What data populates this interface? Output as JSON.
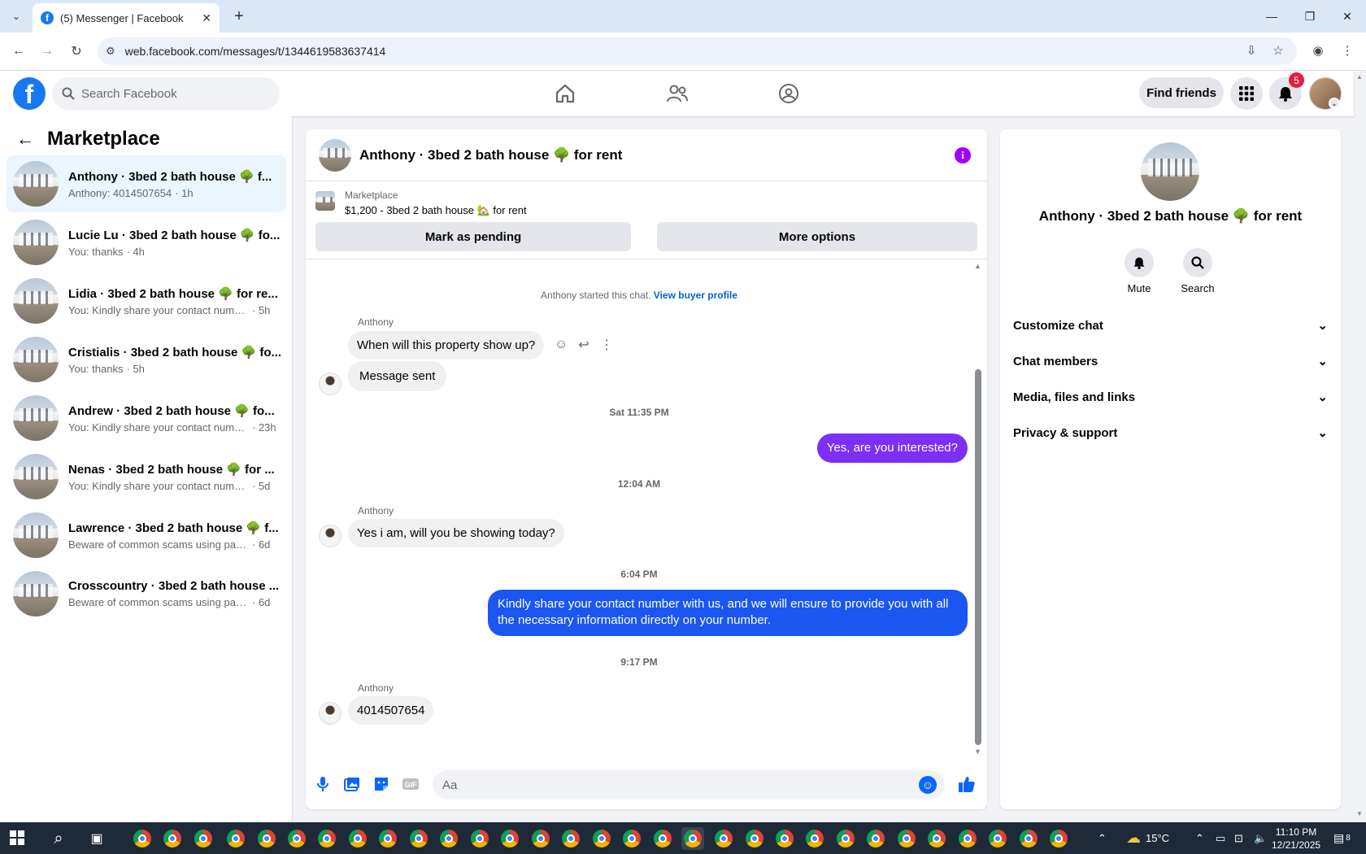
{
  "browser": {
    "tab_title": "(5) Messenger | Facebook",
    "url": "web.facebook.com/messages/t/1344619583637414"
  },
  "header": {
    "search_placeholder": "Search Facebook",
    "find_friends": "Find friends",
    "notifications_count": "5",
    "brand_color": "#1877f2"
  },
  "sidebar": {
    "title": "Marketplace",
    "conversations": [
      {
        "name": "Anthony · 3bed 2 bath house 🌳 f...",
        "snippet": "Anthony: 4014507654",
        "time": "· 1h",
        "active": true
      },
      {
        "name": "Lucie Lu · 3bed 2 bath house 🌳 fo...",
        "snippet": "You: thanks",
        "time": "· 4h"
      },
      {
        "name": "Lidia · 3bed 2 bath house 🌳 for re...",
        "snippet": "You: Kindly share your contact numbe...",
        "time": "· 5h"
      },
      {
        "name": "Cristialis · 3bed 2 bath house 🌳 fo...",
        "snippet": "You: thanks",
        "time": "· 5h"
      },
      {
        "name": "Andrew · 3bed 2 bath house 🌳 fo...",
        "snippet": "You: Kindly share your contact numb...",
        "time": "· 23h"
      },
      {
        "name": "Nenas · 3bed 2 bath house 🌳 for ...",
        "snippet": "You: Kindly share your contact numbe...",
        "time": "· 5d"
      },
      {
        "name": "Lawrence · 3bed 2 bath house 🌳 f...",
        "snippet": "Beware of common scams using pay...",
        "time": "· 6d"
      },
      {
        "name": "Crosscountry · 3bed 2 bath house ...",
        "snippet": "Beware of common scams using pay...",
        "time": "· 6d"
      }
    ]
  },
  "chat": {
    "title": "Anthony · 3bed 2 bath house 🌳 for rent",
    "listing_label": "Marketplace",
    "listing_detail": "$1,200 - 3bed 2 bath house 🏡 for rent",
    "mark_pending": "Mark as pending",
    "more_options": "More options",
    "started_text": "Anthony started this chat.",
    "view_buyer_profile": "View buyer profile",
    "sender_name": "Anthony",
    "msg1": "When will this property show up?",
    "msg2": "Message sent",
    "stamp1": "Sat 11:35 PM",
    "out1": "Yes, are you interested?",
    "stamp2": "12:04 AM",
    "msg3": "Yes i am, will you be showing today?",
    "stamp3": "6:04 PM",
    "out2": "Kindly share your contact number with us, and we will ensure to provide you with all the necessary information directly on your number.",
    "stamp4": "9:17 PM",
    "msg4": "4014507654",
    "composer_placeholder": "Aa",
    "out1_color": "#7b2ff7",
    "out2_color": "#1a56f0"
  },
  "right_panel": {
    "name": "Anthony · 3bed 2 bath house 🌳 for rent",
    "mute": "Mute",
    "search": "Search",
    "sections": [
      "Customize chat",
      "Chat members",
      "Media, files and links",
      "Privacy & support"
    ]
  },
  "taskbar": {
    "weather": "15°C",
    "time": "11:10 PM",
    "date": "12/21/2025",
    "notif_count": "8"
  }
}
